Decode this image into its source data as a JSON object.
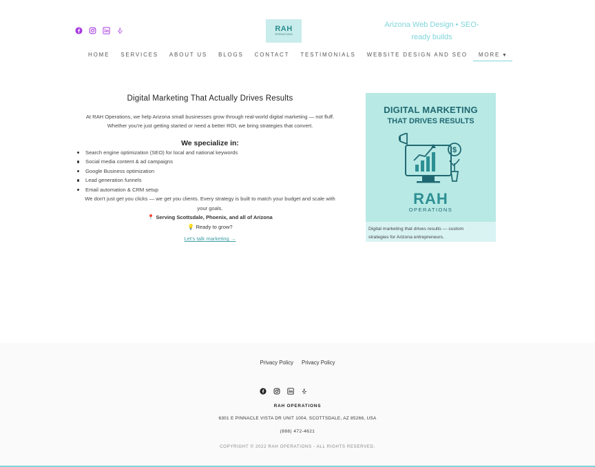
{
  "header": {
    "social_icons": [
      "facebook-icon",
      "instagram-icon",
      "linkedin-icon",
      "yelp-icon"
    ],
    "social_color": "#a83ce0",
    "logo": {
      "line1": "RAH",
      "line2": "OPERATIONS"
    },
    "tagline_line1": "Arizona Web Design • SEO-",
    "tagline_line2": "ready builds",
    "accent": "#7fd5da"
  },
  "nav": {
    "items": [
      "HOME",
      "SERVICES",
      "ABOUT US",
      "BLOGS",
      "CONTACT",
      "TESTIMONIALS",
      "WEBSITE DESIGN AND SEO"
    ],
    "more_label": "MORE",
    "more_icon": "caret-down-icon"
  },
  "main": {
    "title": "Digital Marketing That Actually Drives Results",
    "intro_line1": "At RAH Operations, we help Arizona small businesses grow through real-world digital marketing — not fluff.",
    "intro_line2": "Whether you're just getting started or need a better ROI, we bring strategies that convert.",
    "specialize_heading": "We specialize in:",
    "services": [
      "Search engine optimization (SEO) for local and national keywords",
      "Social media content & ad campaigns",
      "Google Business optimization",
      "Lead generation funnels",
      "Email automation & CRM setup"
    ],
    "body_line1": "We don't just get you clicks — we get you clients. Every strategy is built to match your budget and scale with",
    "body_line2": "your goals.",
    "serving_icon": "📍",
    "serving_text": "Serving Scottsdale, Phoenix, and all of Arizona",
    "ready_icon": "💡",
    "ready_text": "Ready to grow?",
    "cta_label": "Let's talk marketing →"
  },
  "promo": {
    "graphic_line1": "DIGITAL MARKETING",
    "graphic_line2": "THAT DRIVES RESULTS",
    "graphic_brand": "RAH",
    "graphic_brand_sub": "OPERATIONS",
    "caption_line1": "Digital marketing that drives results — custom",
    "caption_line2": "strategies for Arizona entrepreneurs.",
    "bg_color": "#b8e9e4"
  },
  "footer": {
    "links": [
      "Privacy Policy",
      "Privacy Policy"
    ],
    "social_icons": [
      "facebook-icon",
      "instagram-icon",
      "linkedin-icon",
      "yelp-icon"
    ],
    "company": "RAH OPERATIONS",
    "address": "6301 E PINNACLE VISTA DR UNIT 1004, SCOTTSDALE, AZ 85266, USA",
    "phone": "(888) 472-4621",
    "copyright": "COPYRIGHT © 2022 RAH OPERATIONS - ALL RIGHTS RESERVED."
  }
}
